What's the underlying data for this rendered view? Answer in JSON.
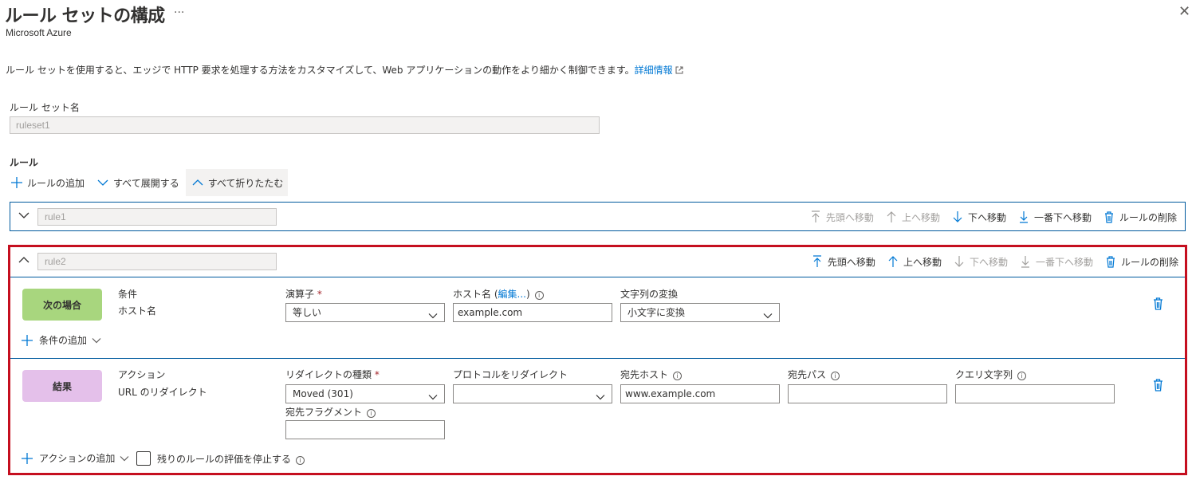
{
  "header": {
    "title": "ルール セットの構成",
    "more": "···",
    "subtitle": "Microsoft Azure",
    "close": "✕"
  },
  "description": {
    "text": "ルール セットを使用すると、エッジで HTTP 要求を処理する方法をカスタマイズして、Web アプリケーションの動作をより細かく制御できます。",
    "link": "詳細情報"
  },
  "ruleset": {
    "label": "ルール セット名",
    "value": "ruleset1"
  },
  "rules_section": {
    "label": "ルール",
    "toolbar": {
      "add": "ルールの追加",
      "expand_all": "すべて展開する",
      "collapse_all": "すべて折りたたむ"
    }
  },
  "rule_actions": {
    "move_top": "先頭へ移動",
    "move_up": "上へ移動",
    "move_down": "下へ移動",
    "move_bottom": "一番下へ移動",
    "delete": "ルールの削除"
  },
  "rule1": {
    "name": "rule1"
  },
  "rule2": {
    "name": "rule2",
    "condition": {
      "pill": "次の場合",
      "label": "条件",
      "type": "ホスト名",
      "operator_label": "演算子",
      "operator_value": "等しい",
      "hostname_label": "ホスト名",
      "hostname_edit": "編集...",
      "hostname_value": "example.com",
      "transform_label": "文字列の変換",
      "transform_value": "小文字に変換",
      "add_condition": "条件の追加"
    },
    "action": {
      "pill": "結果",
      "label": "アクション",
      "type": "URL のリダイレクト",
      "redirect_type_label": "リダイレクトの種類",
      "redirect_type_value": "Moved (301)",
      "protocol_label": "プロトコルをリダイレクト",
      "protocol_value": "",
      "dest_host_label": "宛先ホスト",
      "dest_host_value": "www.example.com",
      "dest_path_label": "宛先パス",
      "dest_path_value": "",
      "query_label": "クエリ文字列",
      "query_value": "",
      "fragment_label": "宛先フラグメント",
      "fragment_value": "",
      "add_action": "アクションの追加",
      "stop_eval": "残りのルールの評価を停止する"
    }
  },
  "colors": {
    "accent": "#0078d4",
    "highlight": "#c50f1f",
    "condition_pill": "#a8d67e",
    "action_pill": "#e4c0ea"
  }
}
